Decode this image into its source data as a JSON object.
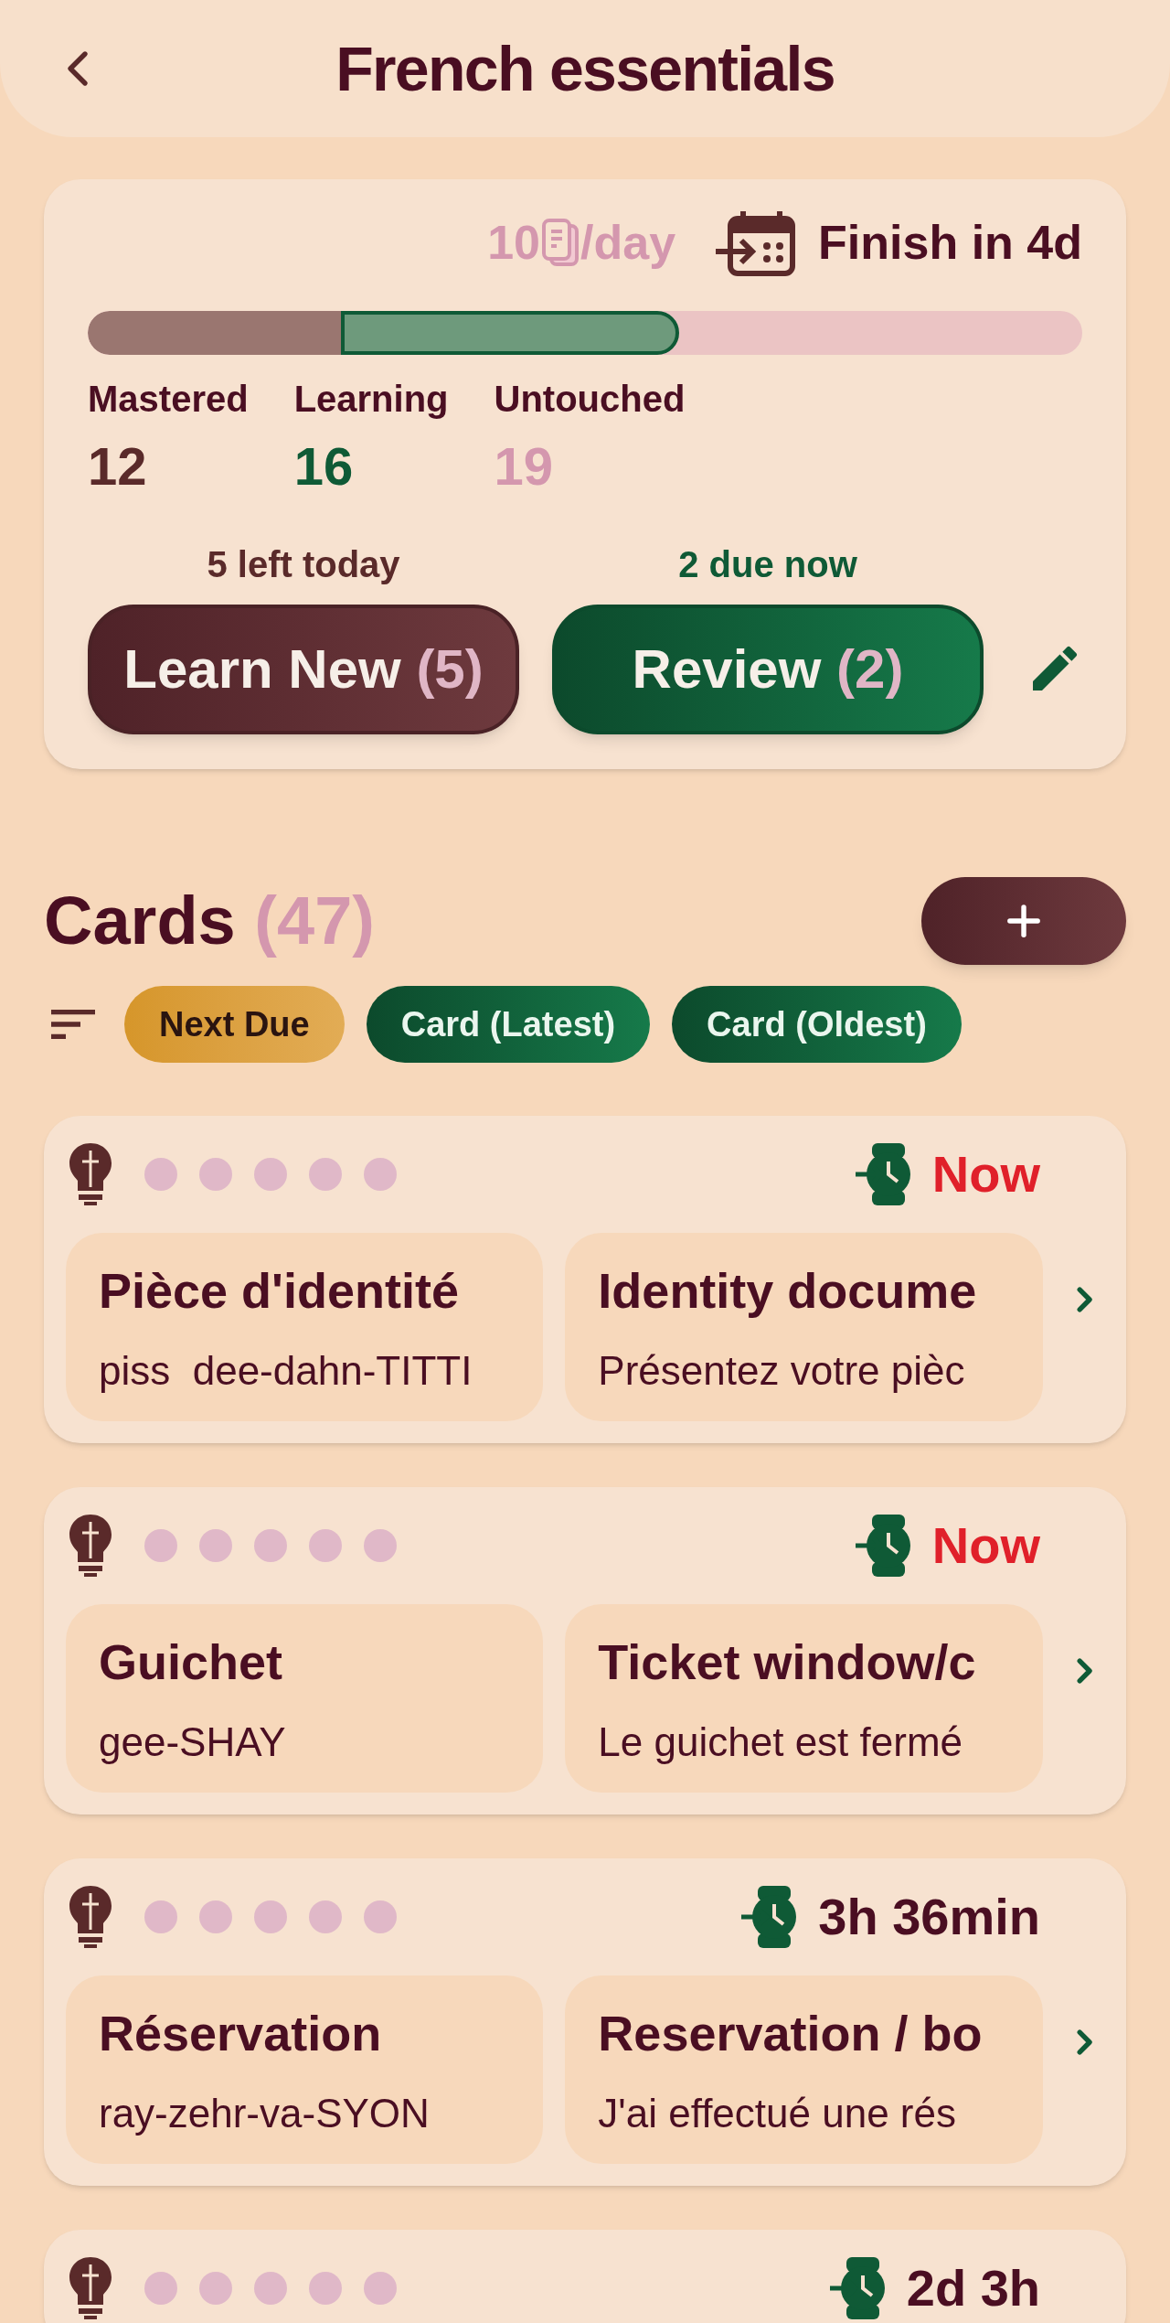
{
  "header": {
    "title": "French essentials"
  },
  "summary": {
    "daily_count": "10",
    "daily_unit": "/day",
    "finish": "Finish in 4d",
    "progress": [
      {
        "kind": "mastered",
        "level": 0.255
      },
      {
        "kind": "learning",
        "level": 0.34
      }
    ],
    "stats": [
      {
        "kind": "mastered",
        "label": "Mastered",
        "value": "12"
      },
      {
        "kind": "learning",
        "label": "Learning",
        "value": "16"
      },
      {
        "kind": "untouched",
        "label": "Untouched",
        "value": "19"
      }
    ],
    "actions": [
      {
        "kind": "learn",
        "caption_count": "5",
        "caption": "left today",
        "label": "Learn New",
        "count": "(5)"
      },
      {
        "kind": "review",
        "caption_count": "2",
        "caption": "due now",
        "label": "Review",
        "count": "(2)"
      }
    ]
  },
  "cards_section": {
    "title": "Cards",
    "count": "(47)",
    "sort_options": [
      {
        "label": "Next Due",
        "selected": true
      },
      {
        "label": "Card (Latest)",
        "selected": false
      },
      {
        "label": "Card (Oldest)",
        "selected": false
      }
    ]
  },
  "cards": [
    {
      "due": "Now",
      "overdue": true,
      "front": {
        "word": "Pièce d'identité",
        "hint": "piss  dee-dahn-TITTI"
      },
      "back": {
        "word": "Identity docume",
        "hint": "Présentez votre pièc"
      }
    },
    {
      "due": "Now",
      "overdue": true,
      "front": {
        "word": "Guichet",
        "hint": "gee-SHAY"
      },
      "back": {
        "word": "Ticket window/c",
        "hint": "Le guichet est fermé"
      }
    },
    {
      "due": "3h 36min",
      "overdue": false,
      "front": {
        "word": "Réservation",
        "hint": "ray-zehr-va-SYON"
      },
      "back": {
        "word": "Reservation / bo",
        "hint": "J'ai effectué une rés"
      }
    },
    {
      "due": "2d 3h",
      "overdue": false
    }
  ]
}
